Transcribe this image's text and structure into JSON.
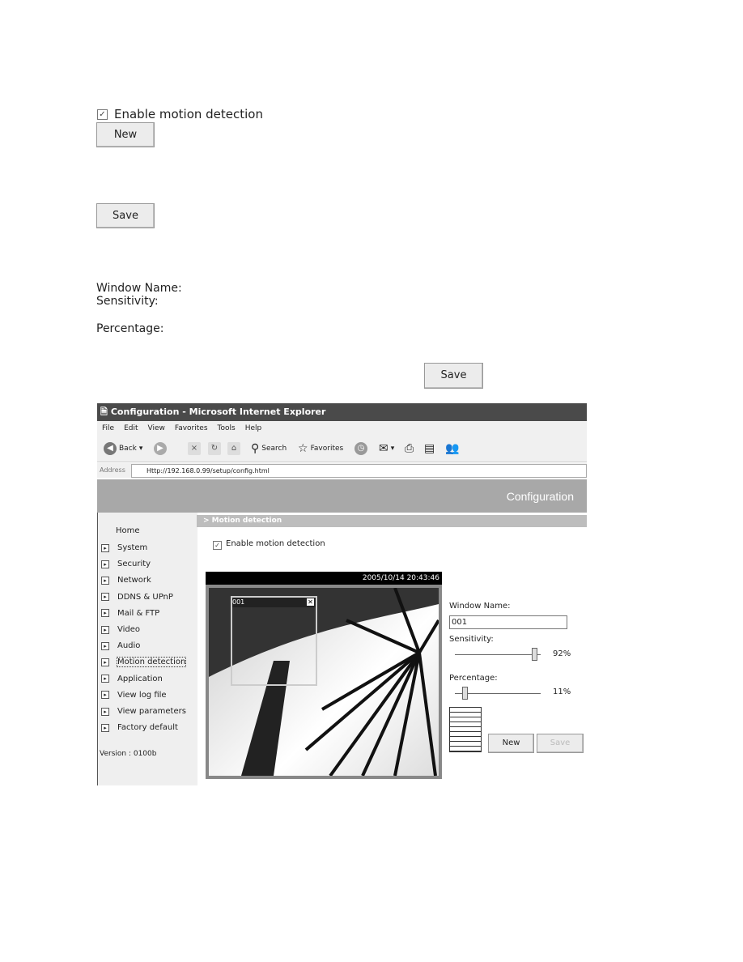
{
  "doc": {
    "enable_label": "Enable motion detection",
    "enable_checked": true,
    "new_label": "New",
    "save_label_1": "Save",
    "window_name_label": "Window Name:",
    "sensitivity_label": "Sensitivity:",
    "percentage_label": "Percentage:",
    "save_label_2": "Save"
  },
  "browser": {
    "title": "Configuration - Microsoft Internet Explorer",
    "menu": [
      "File",
      "Edit",
      "View",
      "Favorites",
      "Tools",
      "Help"
    ],
    "toolbar": {
      "back": "Back",
      "search": "Search",
      "favorites": "Favorites"
    },
    "address_label": "Address",
    "url": "Http://192.168.0.99/setup/config.html"
  },
  "page": {
    "header_title": "Configuration",
    "breadcrumb": "> Motion detection",
    "sidebar": {
      "home": "Home",
      "items": [
        "System",
        "Security",
        "Network",
        "DDNS & UPnP",
        "Mail & FTP",
        "Video",
        "Audio",
        "Motion detection",
        "Application",
        "View log file",
        "View parameters",
        "Factory default"
      ],
      "version": "Version : 0100b"
    },
    "enable_label": "Enable motion detection",
    "enable_checked": true,
    "timestamp": "2005/10/14 20:43:46",
    "window_label": "001",
    "window_name_label": "Window Name:",
    "window_name_value": "001",
    "sensitivity_label": "Sensitivity:",
    "sensitivity_value": "92%",
    "sensitivity_level": 92,
    "percentage_label": "Percentage:",
    "percentage_value": "11%",
    "percentage_level": 11,
    "new_label": "New",
    "save_label": "Save"
  }
}
